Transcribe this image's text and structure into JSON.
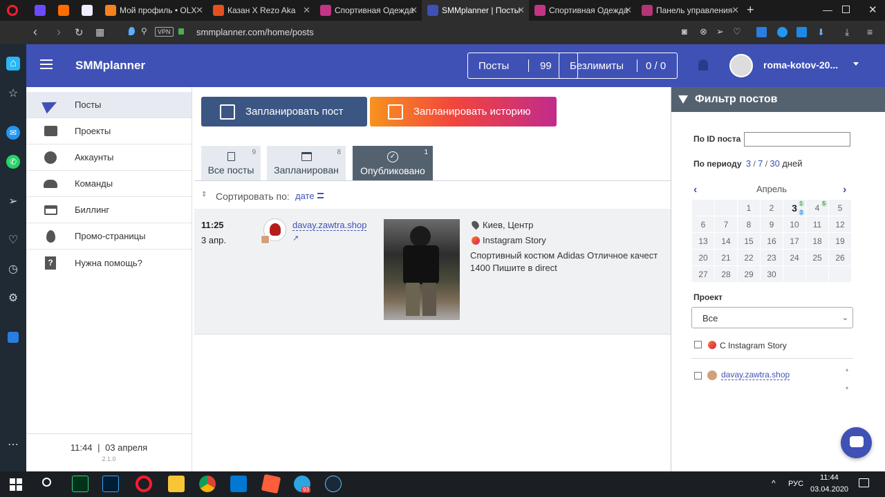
{
  "browser": {
    "tabs": [
      {
        "label": "Мой профиль • OLX",
        "color": "#f58220"
      },
      {
        "label": "Казан X Rezo Aka",
        "color": "#e4511e"
      },
      {
        "label": "Спортивная Одежда",
        "color": "#c13584"
      },
      {
        "label": "SMMplanner | Посты",
        "color": "#3f51b5"
      },
      {
        "label": "Спортивная Одежда",
        "color": "#c13584"
      },
      {
        "label": "Панель управления",
        "color": "#b43573"
      }
    ],
    "url": "smmplanner.com/home/posts",
    "vpn": "VPN"
  },
  "app": {
    "brand": "SMMplanner",
    "posts_label": "Посты",
    "posts_count": "99",
    "limit_label": "Безлимиты",
    "limit_value": "0 / 0",
    "username": "roma-kotov-20..."
  },
  "sidebar": {
    "items": [
      {
        "label": "Посты",
        "icon": "paper-plane-icon"
      },
      {
        "label": "Проекты",
        "icon": "folder-icon"
      },
      {
        "label": "Аккаунты",
        "icon": "globe-icon"
      },
      {
        "label": "Команды",
        "icon": "people-icon"
      },
      {
        "label": "Биллинг",
        "icon": "credit-card-icon"
      },
      {
        "label": "Промо-страницы",
        "icon": "fire-icon"
      },
      {
        "label": "Нужна помощь?",
        "icon": "help-icon"
      }
    ],
    "time": "11:44",
    "sep": "|",
    "date": "03 апреля",
    "version": "2.1.0"
  },
  "main": {
    "schedule_post": "Запланировать пост",
    "schedule_story": "Запланировать историю",
    "tabs": [
      {
        "label": "Все посты",
        "count": "9"
      },
      {
        "label": "Запланирован",
        "count": "8"
      },
      {
        "label": "Опубликовано",
        "count": "1"
      }
    ],
    "sort_label": "Сортировать по:",
    "sort_value": "дате",
    "post": {
      "time": "11:25",
      "date": "3 апр.",
      "account": "davay.zawtra.shop",
      "location": "Киев, Центр",
      "type": "Instagram Story",
      "text_line1": "Спортивный костюм Adidas Отличное качест",
      "text_line2": "1400 Пишите в direct"
    }
  },
  "filter": {
    "title": "Фильтр постов",
    "id_label": "По ID поста",
    "period_label": "По периоду",
    "p3": "3",
    "p7": "7",
    "p30": "30",
    "sl": "/",
    "days": "дней",
    "month": "Апрель",
    "day_rows": [
      [
        "",
        "",
        "1",
        "2",
        "3",
        "4",
        "5"
      ],
      [
        "6",
        "7",
        "8",
        "9",
        "10",
        "11",
        "12"
      ],
      [
        "13",
        "14",
        "15",
        "16",
        "17",
        "18",
        "19"
      ],
      [
        "20",
        "21",
        "22",
        "23",
        "24",
        "25",
        "26"
      ],
      [
        "27",
        "28",
        "29",
        "30",
        "",
        "",
        ""
      ]
    ],
    "badge_3_top": "1",
    "badge_3_bottom": "3",
    "badge_4": "5",
    "project_label": "Проект",
    "project_value": "Все",
    "account1": "С Instagram Story",
    "account2": "davay.zawtra.shop"
  },
  "taskbar": {
    "lang": "РУС",
    "time": "11:44",
    "date": "03.04.2020",
    "telegram_badge": "93"
  }
}
